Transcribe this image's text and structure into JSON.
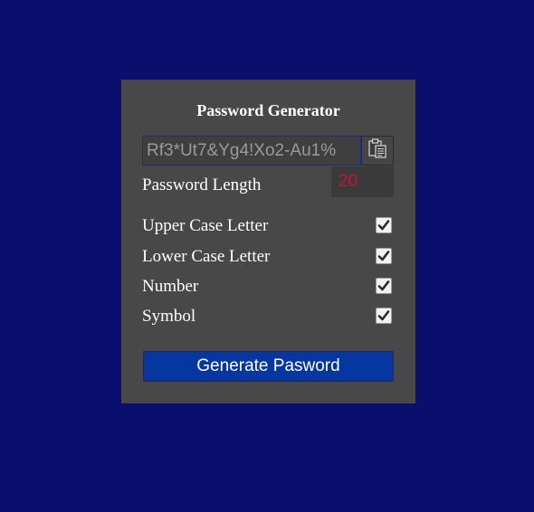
{
  "page": {
    "background_color": "#0a0f6e"
  },
  "card": {
    "title": "Password Generator",
    "password_value": "Rf3*Ut7&Yg4!Xo2-Au1%",
    "copy_icon": "clipboard-icon",
    "length": {
      "label": "Password Length",
      "value": "20"
    },
    "options": [
      {
        "label": "Upper Case Letter",
        "checked": true
      },
      {
        "label": "Lower Case Letter",
        "checked": true
      },
      {
        "label": "Number",
        "checked": true
      },
      {
        "label": "Symbol",
        "checked": true
      }
    ],
    "generate_label": "Generate Pasword"
  }
}
